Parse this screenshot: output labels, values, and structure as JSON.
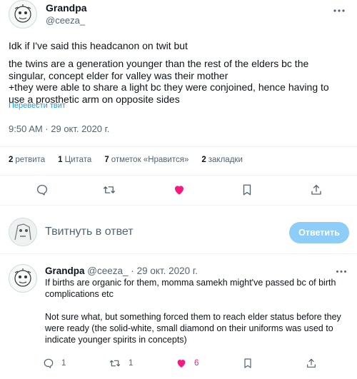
{
  "colors": {
    "accent": "#1d9bf0",
    "like": "#f91880",
    "muted": "#536471",
    "reply_button_disabled": "#8ecdf8"
  },
  "tweet": {
    "author_name": "Grandpa",
    "author_handle": "@ceeza_",
    "text_lines": [
      "Idk if I've said this headcanon on twit but",
      "the twins are a generation younger than the rest of the elders bc the",
      "singular, concept elder for valley was their mother",
      "+they were able to share a light bc they were conjoined, hence having to",
      "use a prosthetic arm on opposite sides"
    ],
    "translate_link": "Перевести твит",
    "time": "9:50 AM · 29 окт. 2020 г."
  },
  "stats": {
    "retweets_count": "2",
    "retweets_label": "ретвита",
    "quotes_count": "1",
    "quotes_label": "Цитата",
    "likes_count": "7",
    "likes_label": "отметок «Нравится»",
    "bookmarks_count": "2",
    "bookmarks_label": "закладки"
  },
  "actions": {
    "icons": [
      "reply-icon",
      "retweet-icon",
      "like-icon",
      "bookmark-icon",
      "share-icon"
    ],
    "liked": true
  },
  "compose": {
    "placeholder": "Твитнуть в ответ",
    "reply_button": "Ответить"
  },
  "reply": {
    "author_name": "Grandpa",
    "author_handle": "@ceeza_",
    "separator": "·",
    "date": "29 окт. 2020 г.",
    "paragraph1": "If births are organic for them, momma samekh might've passed bc of birth complications etc",
    "paragraph2": "Not sure what, but something forced them to reach elder status before they were ready (the solid-white, small diamond on their uniforms was used to indicate younger spirits in concepts)",
    "reply_count": "1",
    "retweet_count": "1",
    "like_count": "6",
    "liked": true
  }
}
